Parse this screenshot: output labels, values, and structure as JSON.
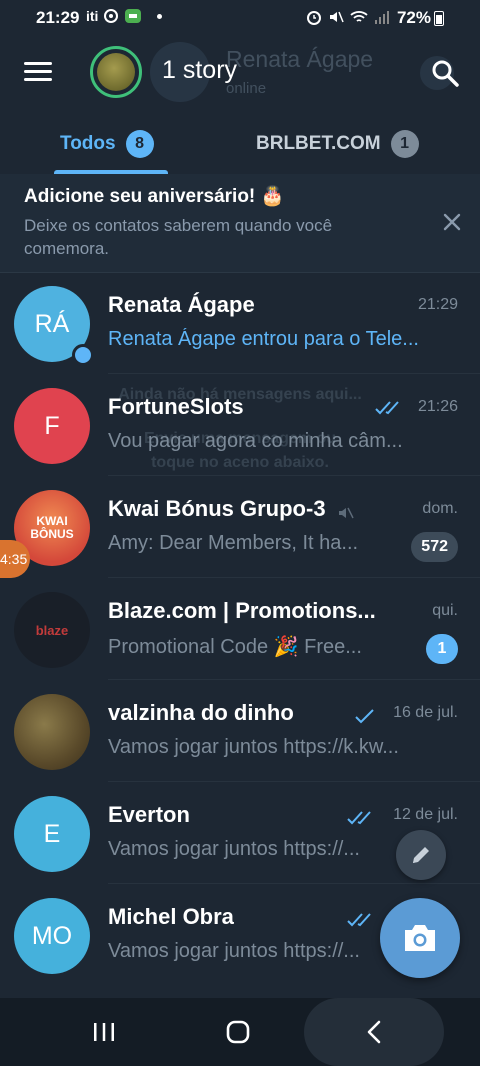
{
  "status_bar": {
    "time": "21:29",
    "carrier": "iti",
    "battery": "72%"
  },
  "header": {
    "story_label": "1 story",
    "ghost_name": "Renata Ágape",
    "ghost_status": "online"
  },
  "tabs": [
    {
      "label": "Todos",
      "count": "8"
    },
    {
      "label": "BRLBET.COM",
      "count": "1"
    }
  ],
  "banner": {
    "title": "Adicione seu aniversário! 🎂",
    "text": "Deixe os contatos saberem quando você comemora."
  },
  "overlay": {
    "line1": "Ainda não há mensagens aqui...",
    "line2": "Envie uma mensagem ou",
    "line3": "toque no aceno abaixo."
  },
  "floating_time": "4:35",
  "chats": [
    {
      "name": "Renata Ágape",
      "time": "21:29",
      "preview": "Renata Ágape entrou para o Tele...",
      "avatar_text": "RÁ",
      "avatar_color": "#4fb2e0"
    },
    {
      "name": "FortuneSlots",
      "time": "21:26",
      "preview": "Vou pagar agora co minha câm...",
      "avatar_text": "F",
      "avatar_color": "#e0434f"
    },
    {
      "name": "Kwai Bónus Grupo-3",
      "time": "dom.",
      "preview": "Amy: Dear Members,  It ha...",
      "avatar_text": "KWAI BÔNUS",
      "unread": "572"
    },
    {
      "name": "Blaze.com | Promotions...",
      "time": "qui.",
      "preview": "Promotional Code 🎉  Free...",
      "avatar_text": "blaze",
      "unread": "1"
    },
    {
      "name": "valzinha do dinho",
      "time": "16 de jul.",
      "preview": "Vamos jogar juntos https://k.kw..."
    },
    {
      "name": "Everton",
      "time": "12 de jul.",
      "preview": "Vamos jogar juntos https://...",
      "avatar_text": "E",
      "avatar_color": "#45b1dc"
    },
    {
      "name": "Michel Obra",
      "time": "",
      "preview": "Vamos jogar juntos https://...",
      "avatar_text": "MO",
      "avatar_color": "#45b1dc"
    }
  ]
}
